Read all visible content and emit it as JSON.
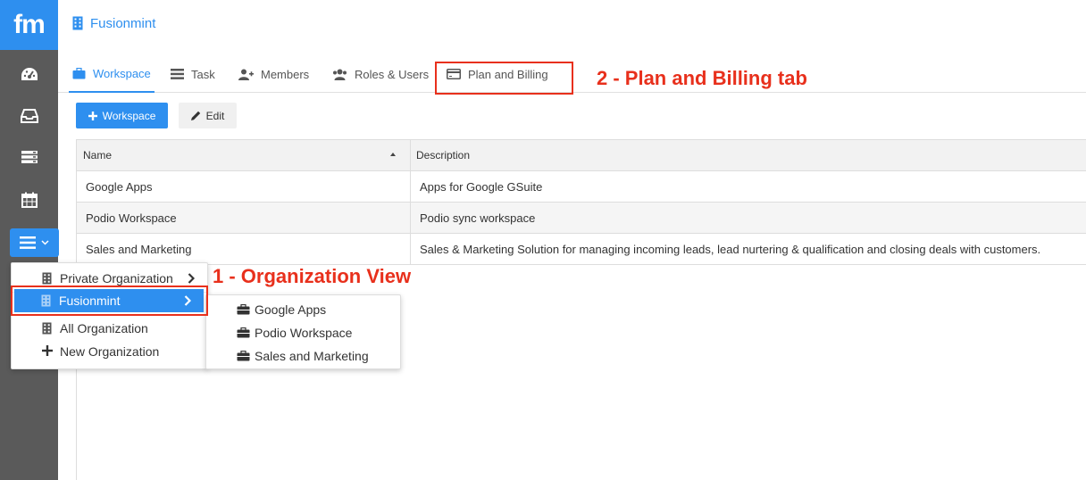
{
  "app": {
    "logo_text": "fm",
    "org_title": "Fusionmint",
    "accent_color": "#2e8fef",
    "sidebar_bg": "#5a5a5a"
  },
  "sidebar": {
    "icons": [
      "dashboard-icon",
      "inbox-icon",
      "server-icon",
      "calendar-icon"
    ],
    "menu_button": "menu-icon"
  },
  "tabs": [
    {
      "label": "Workspace",
      "icon": "briefcase-icon",
      "active": true
    },
    {
      "label": "Task",
      "icon": "tasks-icon",
      "active": false
    },
    {
      "label": "Members",
      "icon": "user-plus-icon",
      "active": false
    },
    {
      "label": "Roles & Users",
      "icon": "users-icon",
      "active": false
    },
    {
      "label": "Plan and Billing",
      "icon": "credit-card-icon",
      "active": false
    }
  ],
  "toolbar": {
    "add_label": "Workspace",
    "edit_label": "Edit"
  },
  "table": {
    "columns": [
      "Name",
      "Description"
    ],
    "rows": [
      {
        "name": "Google Apps",
        "description": "Apps for Google GSuite"
      },
      {
        "name": "Podio Workspace",
        "description": "Podio sync workspace"
      },
      {
        "name": "Sales and Marketing",
        "description": "Sales & Marketing Solution for managing incoming leads, lead nurtering & qualification and closing deals with customers."
      }
    ]
  },
  "org_menu": {
    "items": [
      {
        "label": "Private Organization",
        "has_submenu": true
      },
      {
        "label": "Fusionmint",
        "has_submenu": true,
        "active": true
      },
      {
        "label": "All Organization",
        "has_submenu": false
      },
      {
        "label": "New Organization",
        "has_submenu": false
      }
    ],
    "submenu": [
      "Google Apps",
      "Podio Workspace",
      "Sales and Marketing"
    ]
  },
  "annotations": {
    "org_view": "1 - Organization View",
    "billing_tab": "2 - Plan and Billing tab",
    "color": "#e8301c"
  }
}
